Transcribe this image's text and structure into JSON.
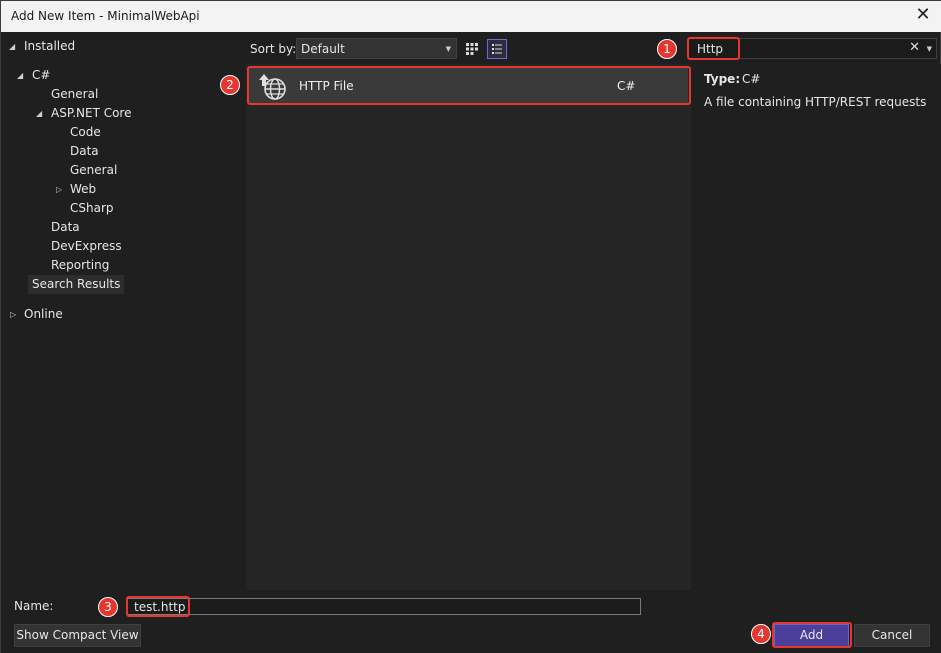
{
  "window": {
    "title": "Add New Item - MinimalWebApi",
    "close_glyph": "✕"
  },
  "tree": {
    "installed": "Installed",
    "csharp": "C#",
    "general": "General",
    "aspnet": "ASP.NET Core",
    "code": "Code",
    "data": "Data",
    "general2": "General",
    "web": "Web",
    "csharp_sub": "CSharp",
    "data2": "Data",
    "devexpress": "DevExpress",
    "reporting": "Reporting",
    "search_results": "Search Results",
    "online": "Online"
  },
  "toolbar": {
    "sort_label": "Sort by:",
    "sort_value": "Default"
  },
  "search": {
    "value": "Http",
    "clear_glyph": "✕"
  },
  "list": {
    "items": [
      {
        "name": "HTTP File",
        "language": "C#"
      }
    ]
  },
  "details": {
    "type_label": "Type:",
    "type_value": "C#",
    "description": "A file containing HTTP/REST requests"
  },
  "bottom": {
    "name_label": "Name:",
    "name_value": "test.http",
    "compact_view": "Show Compact View",
    "add": "Add",
    "cancel": "Cancel"
  },
  "annotations": {
    "c1": "1",
    "c2": "2",
    "c3": "3",
    "c4": "4",
    "color": "#e5372f"
  }
}
